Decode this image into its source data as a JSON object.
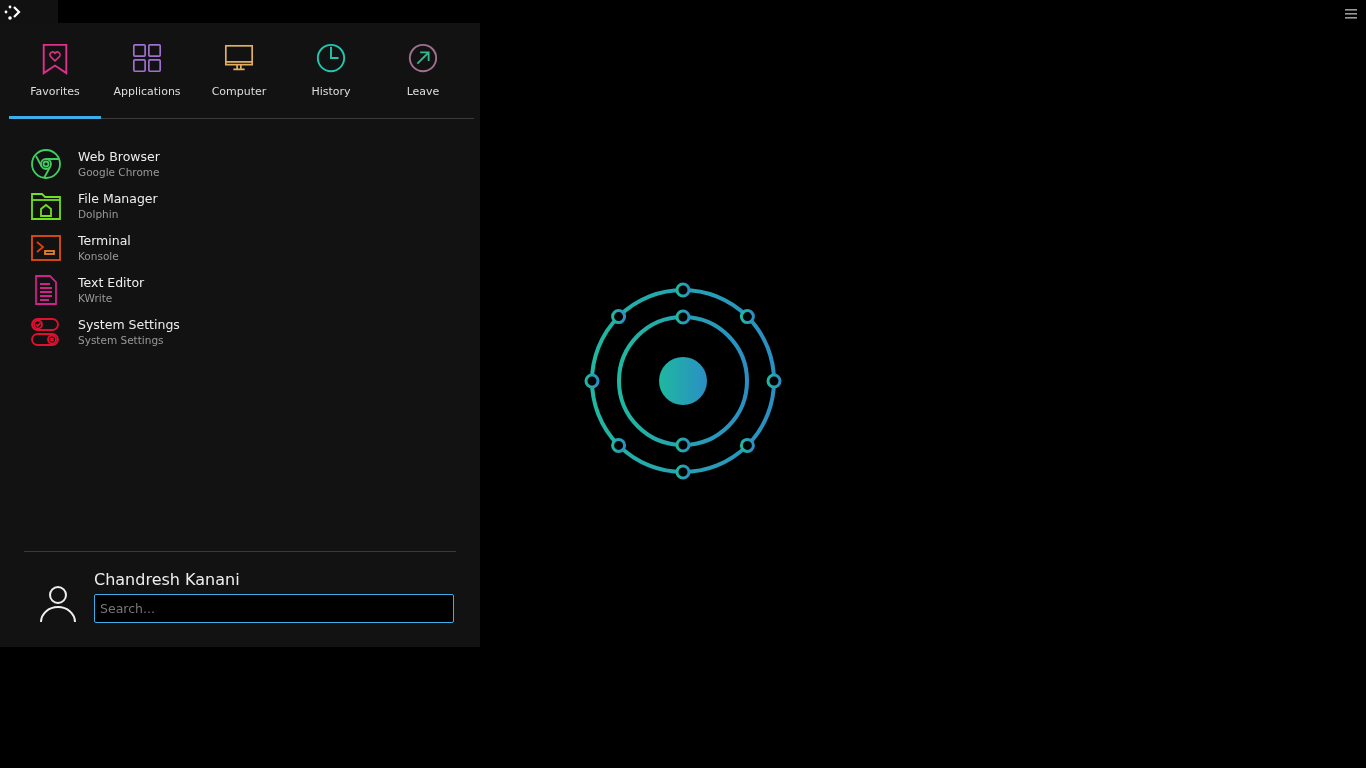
{
  "tabs": [
    {
      "label": "Favorites",
      "selected": true
    },
    {
      "label": "Applications",
      "selected": false
    },
    {
      "label": "Computer",
      "selected": false
    },
    {
      "label": "History",
      "selected": false
    },
    {
      "label": "Leave",
      "selected": false
    }
  ],
  "apps": [
    {
      "name": "Web Browser",
      "app": "Google Chrome"
    },
    {
      "name": "File Manager",
      "app": "Dolphin"
    },
    {
      "name": "Terminal",
      "app": "Konsole"
    },
    {
      "name": "Text Editor",
      "app": "KWrite"
    },
    {
      "name": "System Settings",
      "app": "System Settings"
    }
  ],
  "user": {
    "name": "Chandresh Kanani"
  },
  "search": {
    "placeholder": "Search..."
  }
}
